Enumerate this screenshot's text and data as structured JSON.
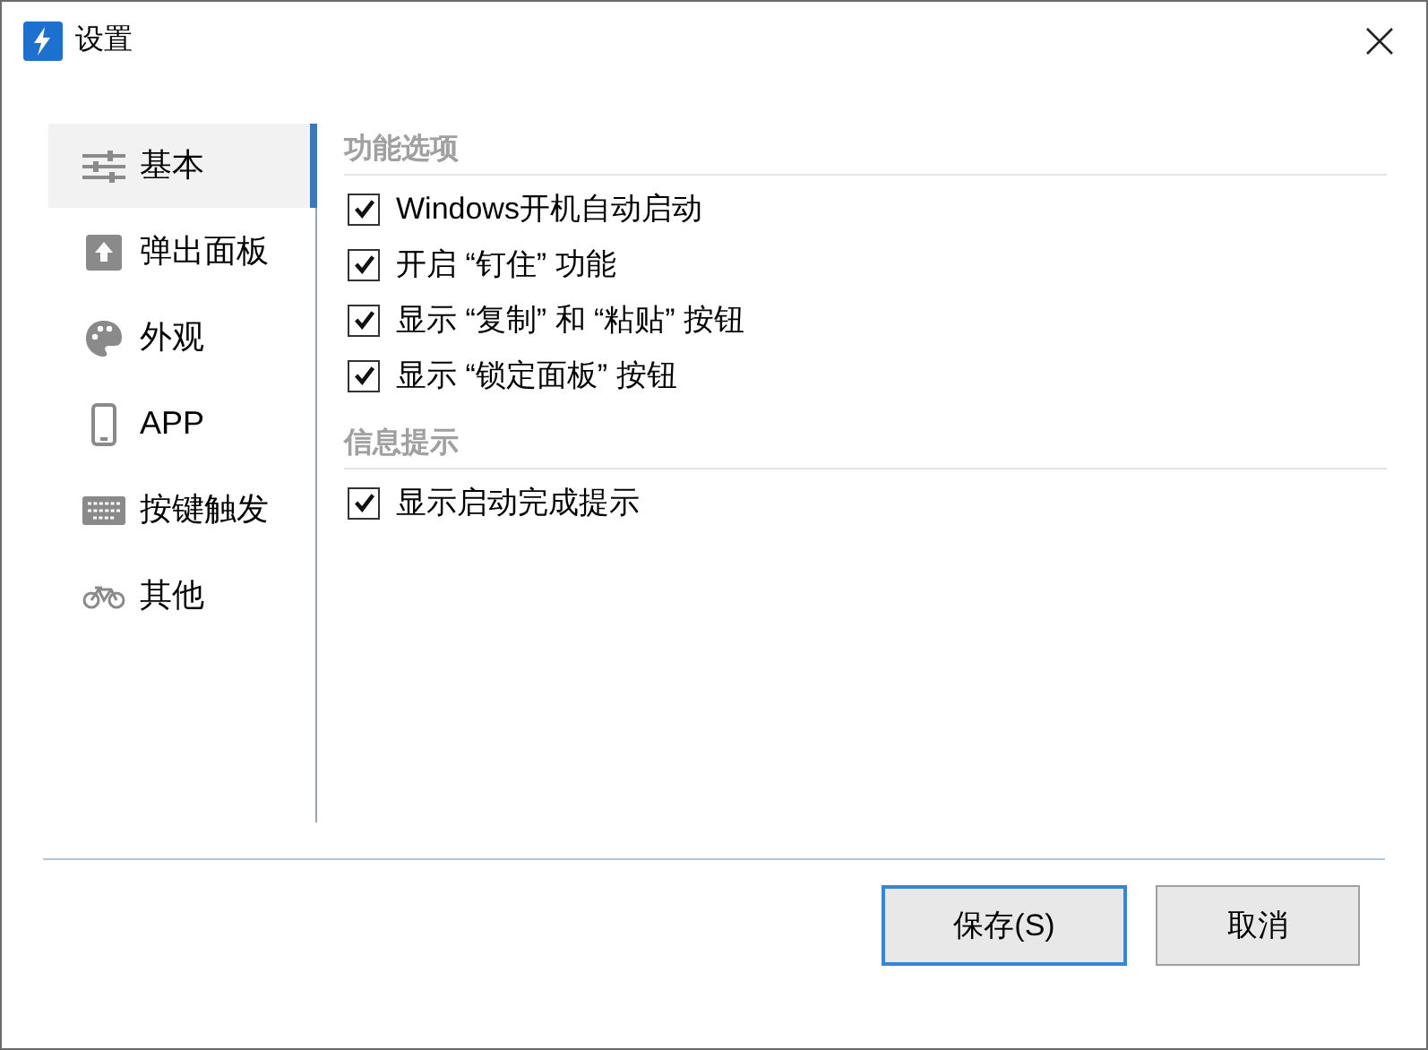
{
  "window": {
    "title": "设置"
  },
  "sidebar": {
    "items": [
      {
        "label": "基本",
        "selected": true
      },
      {
        "label": "弹出面板",
        "selected": false
      },
      {
        "label": "外观",
        "selected": false
      },
      {
        "label": "APP",
        "selected": false
      },
      {
        "label": "按键触发",
        "selected": false
      },
      {
        "label": "其他",
        "selected": false
      }
    ]
  },
  "sections": [
    {
      "title": "功能选项",
      "options": [
        {
          "label": "Windows开机自动启动",
          "checked": true
        },
        {
          "label": "开启 “钉住” 功能",
          "checked": true
        },
        {
          "label": "显示 “复制” 和 “粘贴” 按钮",
          "checked": true
        },
        {
          "label": "显示 “锁定面板” 按钮",
          "checked": true
        }
      ]
    },
    {
      "title": "信息提示",
      "options": [
        {
          "label": "显示启动完成提示",
          "checked": true
        }
      ]
    }
  ],
  "buttons": [
    {
      "label": "保存(S)",
      "kind": "primary"
    },
    {
      "label": "取消",
      "kind": "secondary"
    }
  ]
}
